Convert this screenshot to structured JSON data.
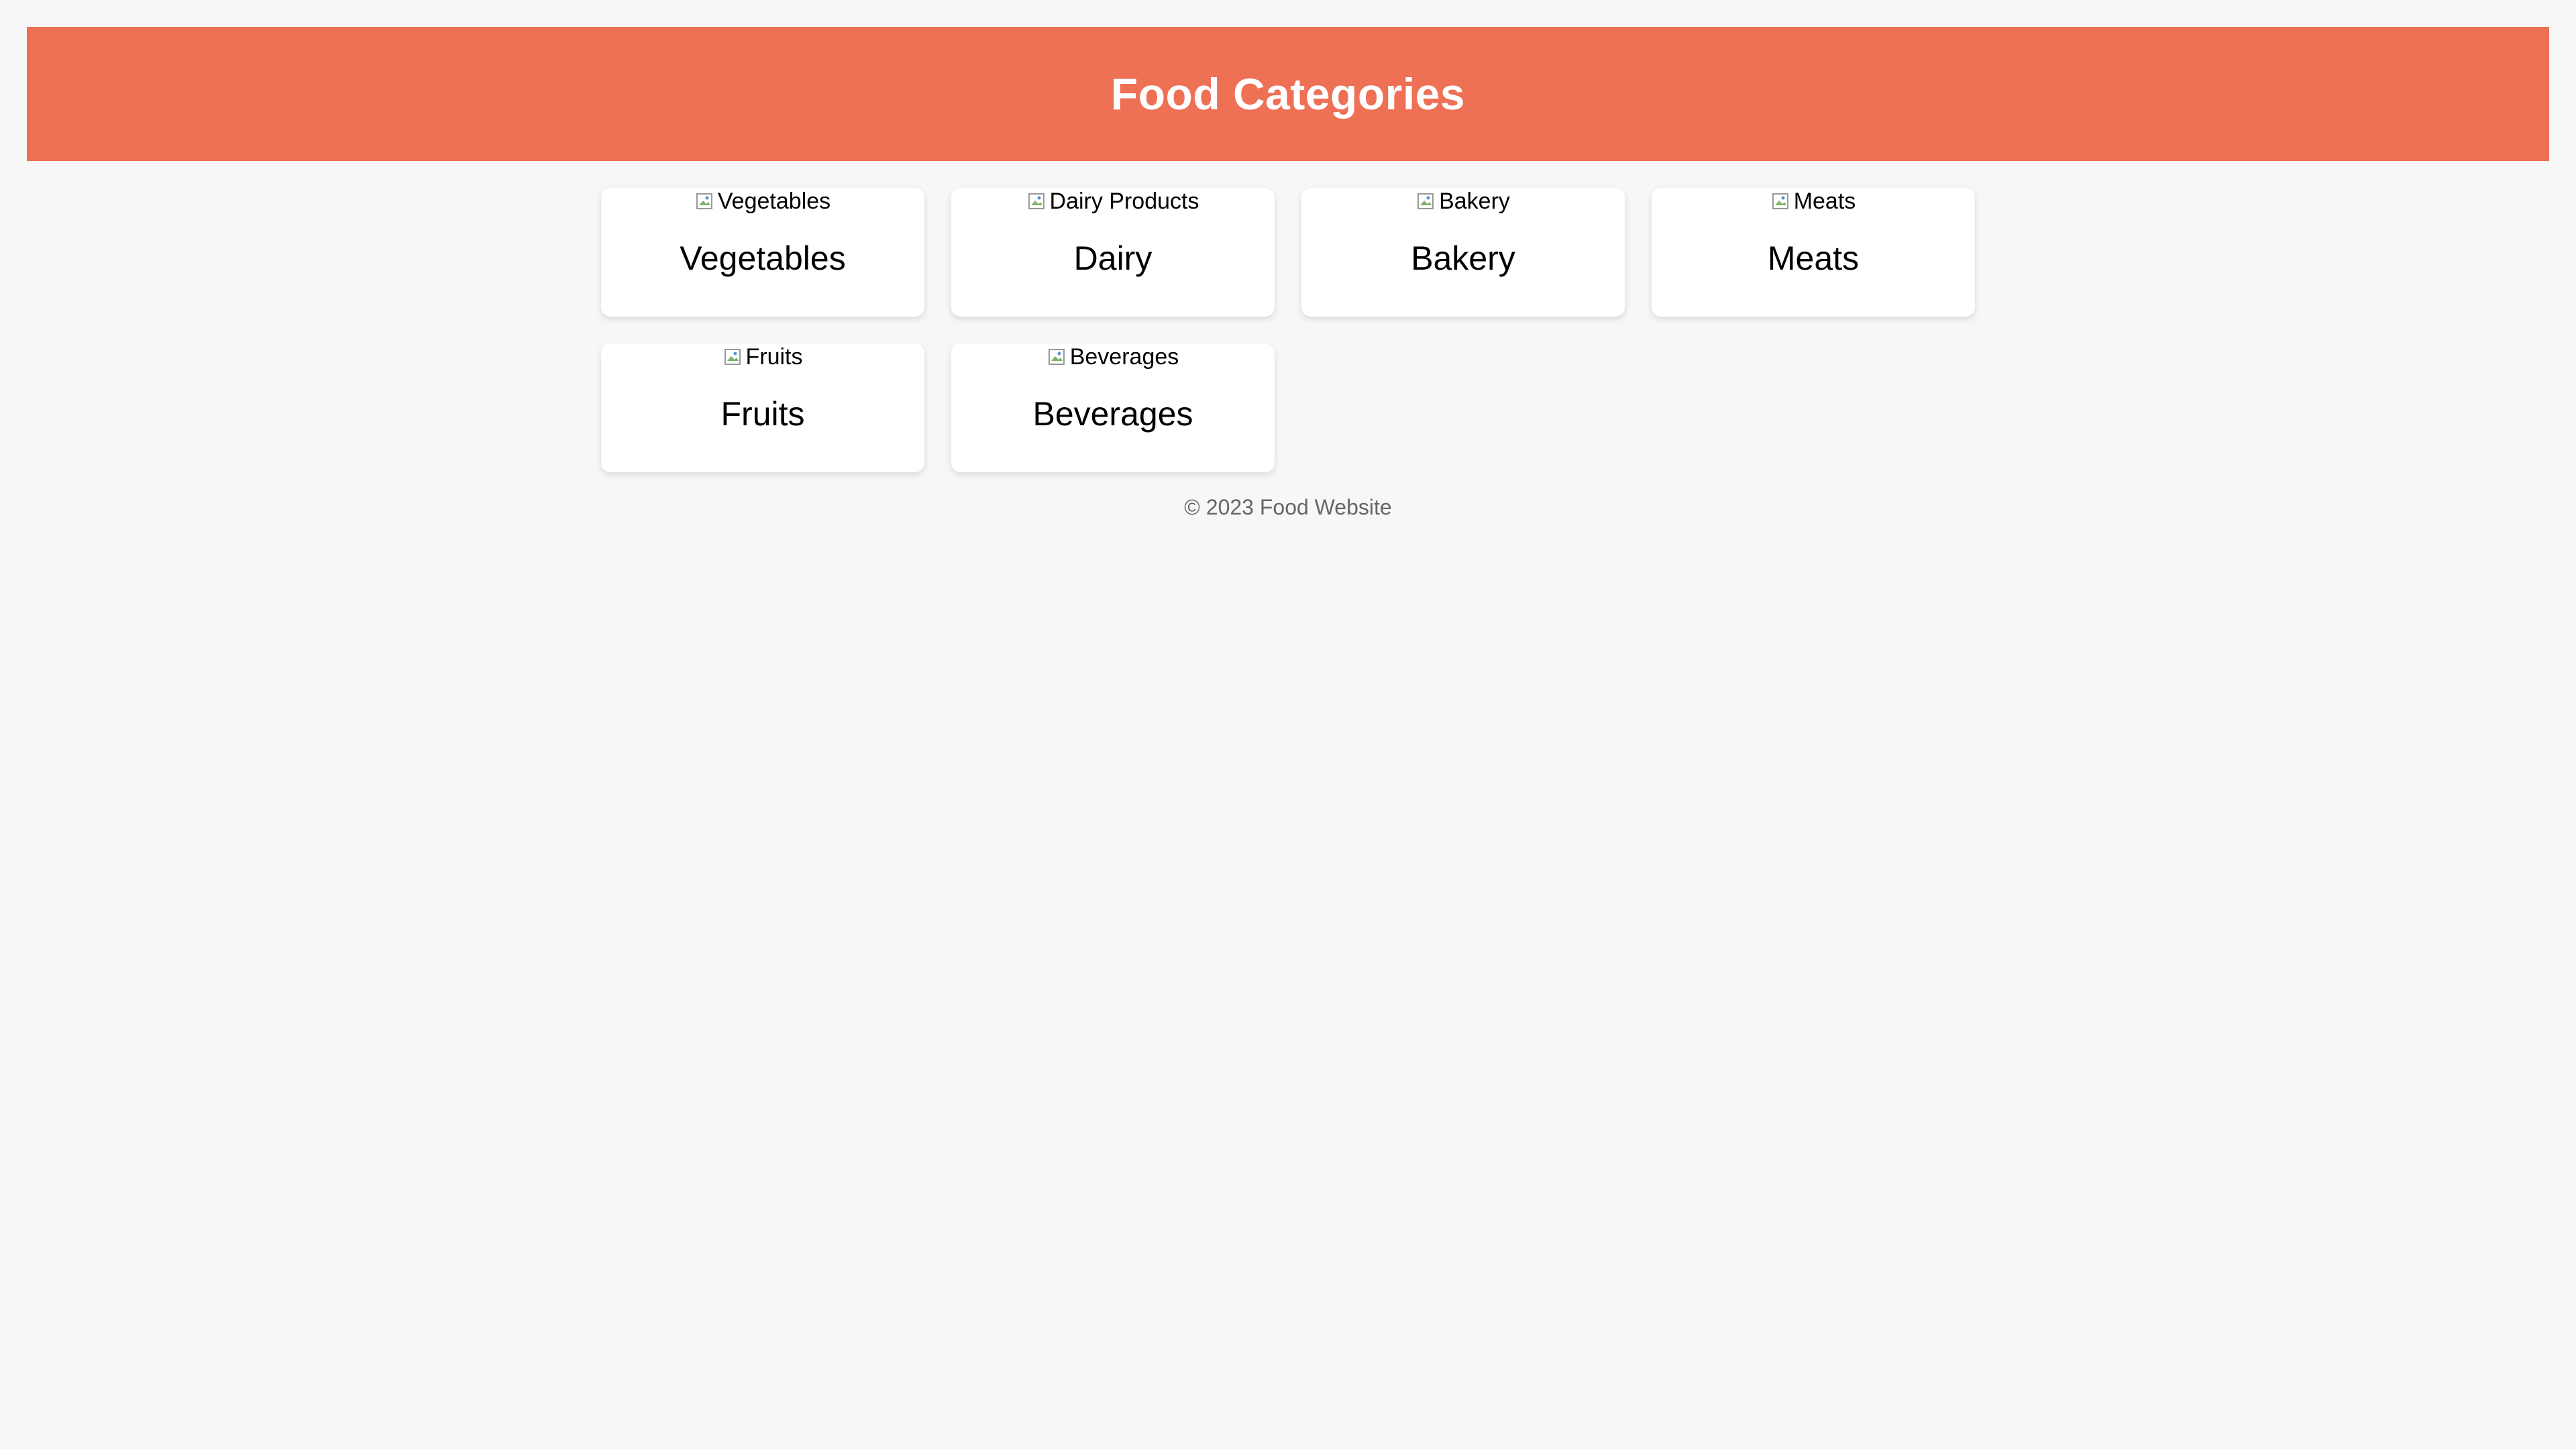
{
  "header": {
    "title": "Food Categories",
    "background_color": "#ee7055"
  },
  "categories": [
    {
      "alt": "Vegetables",
      "label": "Vegetables"
    },
    {
      "alt": "Dairy Products",
      "label": "Dairy"
    },
    {
      "alt": "Bakery",
      "label": "Bakery"
    },
    {
      "alt": "Meats",
      "label": "Meats"
    },
    {
      "alt": "Fruits",
      "label": "Fruits"
    },
    {
      "alt": "Beverages",
      "label": "Beverages"
    }
  ],
  "footer": {
    "text": "© 2023 Food Website"
  },
  "icons": {
    "image_placeholder": "broken-image-icon"
  }
}
